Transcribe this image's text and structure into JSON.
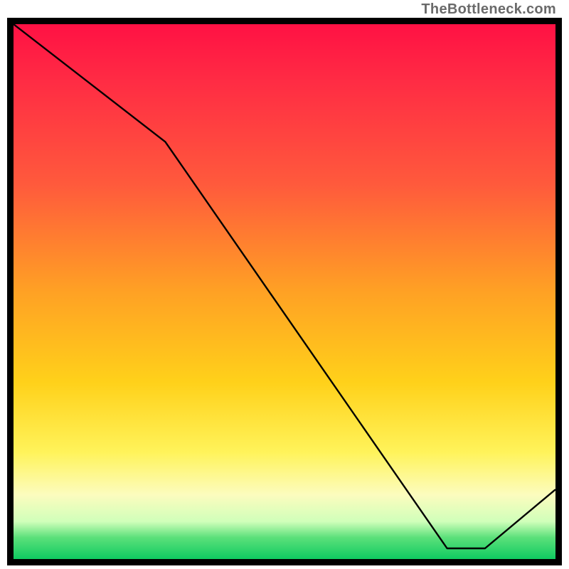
{
  "watermark": "TheBottleneck.com",
  "chart_data": {
    "type": "line",
    "title": "",
    "xlabel": "",
    "ylabel": "",
    "xlim": [
      0,
      100
    ],
    "ylim": [
      0,
      100
    ],
    "grid": false,
    "series": [
      {
        "name": "",
        "x": [
          0,
          28,
          80,
          87,
          100
        ],
        "values": [
          100,
          78,
          2,
          2,
          13
        ]
      }
    ],
    "annotations": [
      {
        "text": "",
        "x": 83.5,
        "y": 2.5
      }
    ],
    "background": "vertical-gradient red→orange→yellow→green"
  }
}
